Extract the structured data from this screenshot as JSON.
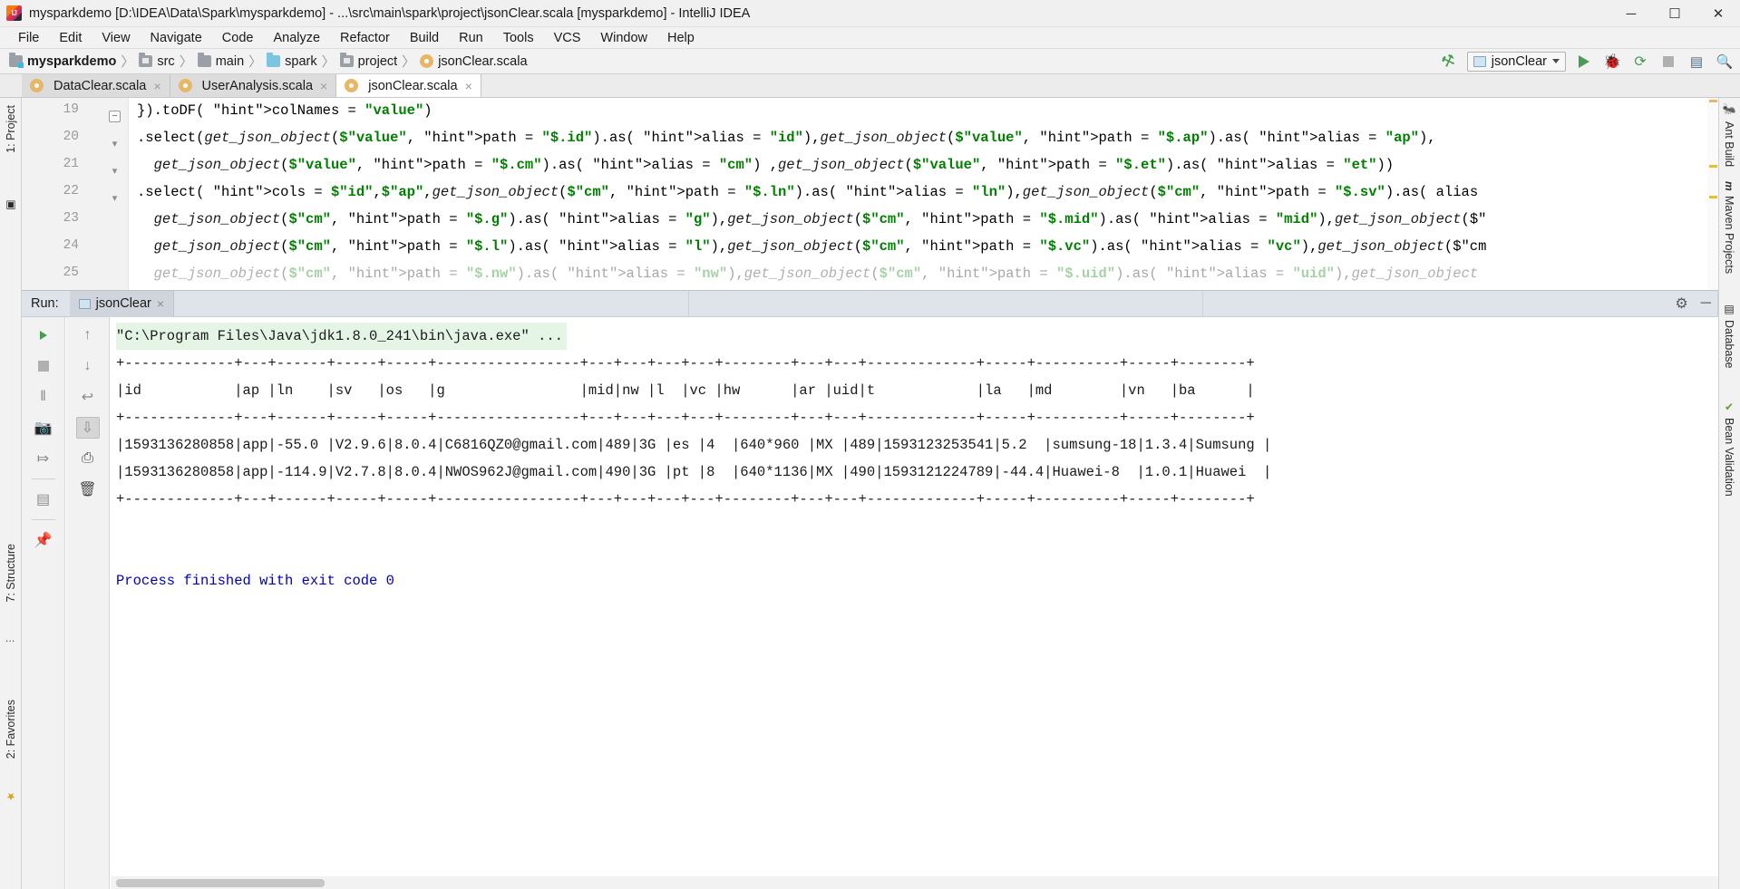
{
  "window": {
    "title": "mysparkdemo [D:\\IDEA\\Data\\Spark\\mysparkdemo] - ...\\src\\main\\spark\\project\\jsonClear.scala [mysparkdemo] - IntelliJ IDEA",
    "logo_label": "IJ",
    "controls": {
      "minimize": "─",
      "maximize": "☐",
      "close": "✕"
    }
  },
  "menubar": {
    "items": [
      {
        "label": "File"
      },
      {
        "label": "Edit"
      },
      {
        "label": "View"
      },
      {
        "label": "Navigate"
      },
      {
        "label": "Code"
      },
      {
        "label": "Analyze"
      },
      {
        "label": "Refactor"
      },
      {
        "label": "Build"
      },
      {
        "label": "Run"
      },
      {
        "label": "Tools"
      },
      {
        "label": "VCS"
      },
      {
        "label": "Window"
      },
      {
        "label": "Help"
      }
    ]
  },
  "navbar": {
    "breadcrumbs": [
      {
        "label": "mysparkdemo",
        "icon": "module-icon"
      },
      {
        "label": "src",
        "icon": "source-folder-icon"
      },
      {
        "label": "main",
        "icon": "folder-icon"
      },
      {
        "label": "spark",
        "icon": "package-folder-icon"
      },
      {
        "label": "project",
        "icon": "package-folder-icon"
      },
      {
        "label": "jsonClear.scala",
        "icon": "scala-file-icon"
      }
    ],
    "separator": "〉",
    "run_configuration": "jsonClear",
    "actions": [
      {
        "name": "build-project-button",
        "glyph": "⚒"
      },
      {
        "name": "run-button",
        "glyph": "▶"
      },
      {
        "name": "debug-button",
        "glyph": "🐞"
      },
      {
        "name": "run-with-coverage-button",
        "glyph": "⟳"
      },
      {
        "name": "stop-button",
        "glyph": "■"
      },
      {
        "name": "project-structure-button",
        "glyph": "▤"
      },
      {
        "name": "search-everywhere-button",
        "glyph": "🔍"
      }
    ]
  },
  "editor_tabs": [
    {
      "label": "DataClear.scala",
      "active": false,
      "close": "×"
    },
    {
      "label": "UserAnalysis.scala",
      "active": false,
      "close": "×"
    },
    {
      "label": "jsonClear.scala",
      "active": true,
      "close": "×"
    }
  ],
  "left_strip": [
    {
      "label": "1: Project",
      "icon": "project-icon"
    },
    {
      "label": "7: Structure",
      "icon": "structure-icon"
    },
    {
      "label": "2: Favorites",
      "icon": "favorites-star-icon"
    }
  ],
  "right_strip": [
    {
      "label": "Ant Build",
      "icon": "ant-icon"
    },
    {
      "label": "Maven Projects",
      "icon": "maven-m-icon"
    },
    {
      "label": "Database",
      "icon": "database-icon"
    },
    {
      "label": "Bean Validation",
      "icon": "bean-validation-icon"
    }
  ],
  "editor": {
    "line_numbers": [
      "19",
      "20",
      "21",
      "22",
      "23",
      "24",
      "25"
    ],
    "lines": [
      "}).toDF( colNames = \"value\")",
      ".select(get_json_object($\"value\", path = \"$.id\").as( alias = \"id\"),get_json_object($\"value\", path = \"$.ap\").as( alias = \"ap\"),",
      "  get_json_object($\"value\", path = \"$.cm\").as( alias = \"cm\") ,get_json_object($\"value\", path = \"$.et\").as( alias = \"et\"))",
      ".select( cols = $\"id\",$\"ap\",get_json_object($\"cm\", path = \"$.ln\").as( alias = \"ln\"),get_json_object($\"cm\", path = \"$.sv\").as( alias",
      "  get_json_object($\"cm\", path = \"$.g\").as( alias = \"g\"),get_json_object($\"cm\", path = \"$.mid\").as( alias = \"mid\"),get_json_object($\"",
      "  get_json_object($\"cm\", path = \"$.l\").as( alias = \"l\"),get_json_object($\"cm\", path = \"$.vc\").as( alias = \"vc\"),get_json_object($\"cm",
      "  get_json_object($\"cm\", path = \"$.nw\").as( alias = \"nw\"),get_json_object($\"cm\", path = \"$.uid\").as( alias = \"uid\"),get_json_object"
    ]
  },
  "run_window": {
    "header_label": "Run:",
    "tab_label": "jsonClear",
    "tab_close": "×",
    "settings_glyph": "⚙",
    "minimize_glyph": "─",
    "left_tools": [
      {
        "name": "rerun-button",
        "glyph": "▶"
      },
      {
        "name": "stop-button",
        "glyph": "■"
      },
      {
        "name": "pause-output-button",
        "glyph": "‖"
      },
      {
        "name": "dump-threads-button",
        "glyph": "📷"
      },
      {
        "name": "restore-layout-button",
        "glyph": "⤇"
      },
      {
        "name": "layout-settings-button",
        "glyph": "▤"
      },
      {
        "name": "pin-tab-button",
        "glyph": "📌"
      }
    ],
    "second_tools": [
      {
        "name": "up-arrow-button",
        "glyph": "↑"
      },
      {
        "name": "down-arrow-button",
        "glyph": "↓"
      },
      {
        "name": "soft-wrap-button",
        "glyph": "↩"
      },
      {
        "name": "scroll-to-end-button",
        "glyph": "⇩"
      },
      {
        "name": "print-button",
        "glyph": "⎙"
      },
      {
        "name": "clear-all-button",
        "glyph": "🗑"
      }
    ],
    "console": {
      "command_line": "\"C:\\Program Files\\Java\\jdk1.8.0_241\\bin\\java.exe\" ...",
      "separator": "+-------------+---+------+-----+-----+-----------------+---+---+---+---+--------+---+---+-------------+-----+----------+-----+--------+",
      "header_row": "|id           |ap |ln    |sv   |os   |g                |mid|nw |l  |vc |hw      |ar |uid|t            |la   |md        |vn   |ba      |",
      "rows": [
        "|1593136280858|app|-55.0 |V2.9.6|8.0.4|C6816QZ0@gmail.com|489|3G |es |4  |640*960 |MX |489|1593123253541|5.2  |sumsung-18|1.3.4|Sumsung |",
        "|1593136280858|app|-114.9|V2.7.8|8.0.4|NWOS962J@gmail.com|490|3G |pt |8  |640*1136|MX |490|1593121224789|-44.4|Huawei-8  |1.0.1|Huawei  |"
      ],
      "exit_message": "Process finished with exit code 0"
    }
  },
  "colors": {
    "accent_green": "#499c54",
    "string_green": "#008000",
    "keyword_blue": "#000080",
    "console_cmd_bg": "#e5f5e5",
    "run_header_bg": "#dfe3ea"
  }
}
